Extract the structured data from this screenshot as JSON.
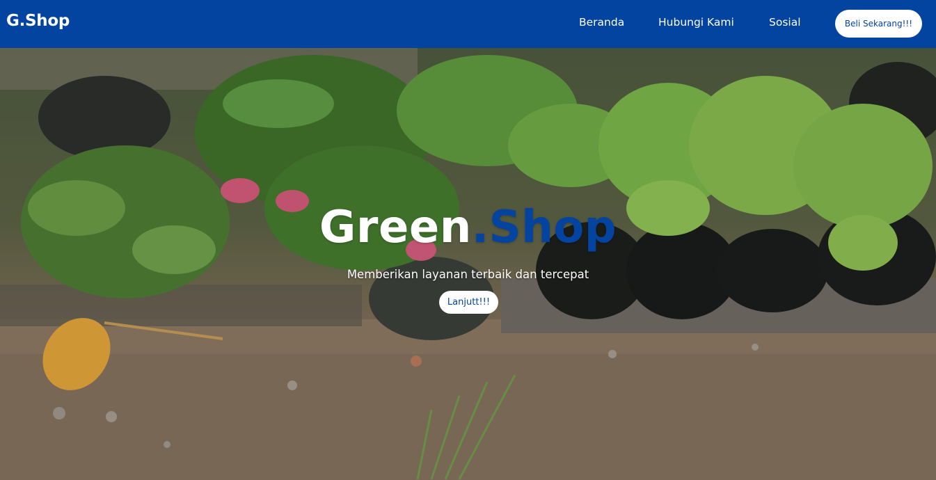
{
  "navbar": {
    "brand": "G.Shop",
    "links": [
      "Beranda",
      "Hubungi Kami",
      "Sosial"
    ],
    "cta": "Beli Sekarang!!!",
    "bg_color": "#0344a1"
  },
  "hero": {
    "title_part1": "Green",
    "title_part2": ".Shop",
    "subtitle": "Memberikan layanan terbaik dan tercepat",
    "button": "Lanjutt!!!",
    "accent_color": "#0344a1"
  }
}
